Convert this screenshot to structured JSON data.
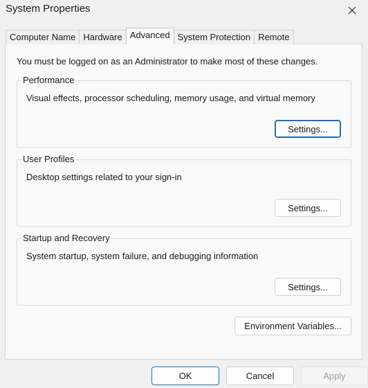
{
  "window": {
    "title": "System Properties",
    "close_icon": "close-icon"
  },
  "tabs": [
    {
      "label": "Computer Name",
      "active": false
    },
    {
      "label": "Hardware",
      "active": false
    },
    {
      "label": "Advanced",
      "active": true
    },
    {
      "label": "System Protection",
      "active": false
    },
    {
      "label": "Remote",
      "active": false
    }
  ],
  "advanced": {
    "admin_note": "You must be logged on as an Administrator to make most of these changes.",
    "groups": [
      {
        "title": "Performance",
        "description": "Visual effects, processor scheduling, memory usage, and virtual memory",
        "button": "Settings..."
      },
      {
        "title": "User Profiles",
        "description": "Desktop settings related to your sign-in",
        "button": "Settings..."
      },
      {
        "title": "Startup and Recovery",
        "description": "System startup, system failure, and debugging information",
        "button": "Settings..."
      }
    ],
    "env_button": "Environment Variables..."
  },
  "footer": {
    "ok": "OK",
    "cancel": "Cancel",
    "apply": "Apply"
  },
  "colors": {
    "background": "#f0f0f0",
    "panel": "#f9f9f9",
    "focus_accent": "#1c6fb5"
  }
}
